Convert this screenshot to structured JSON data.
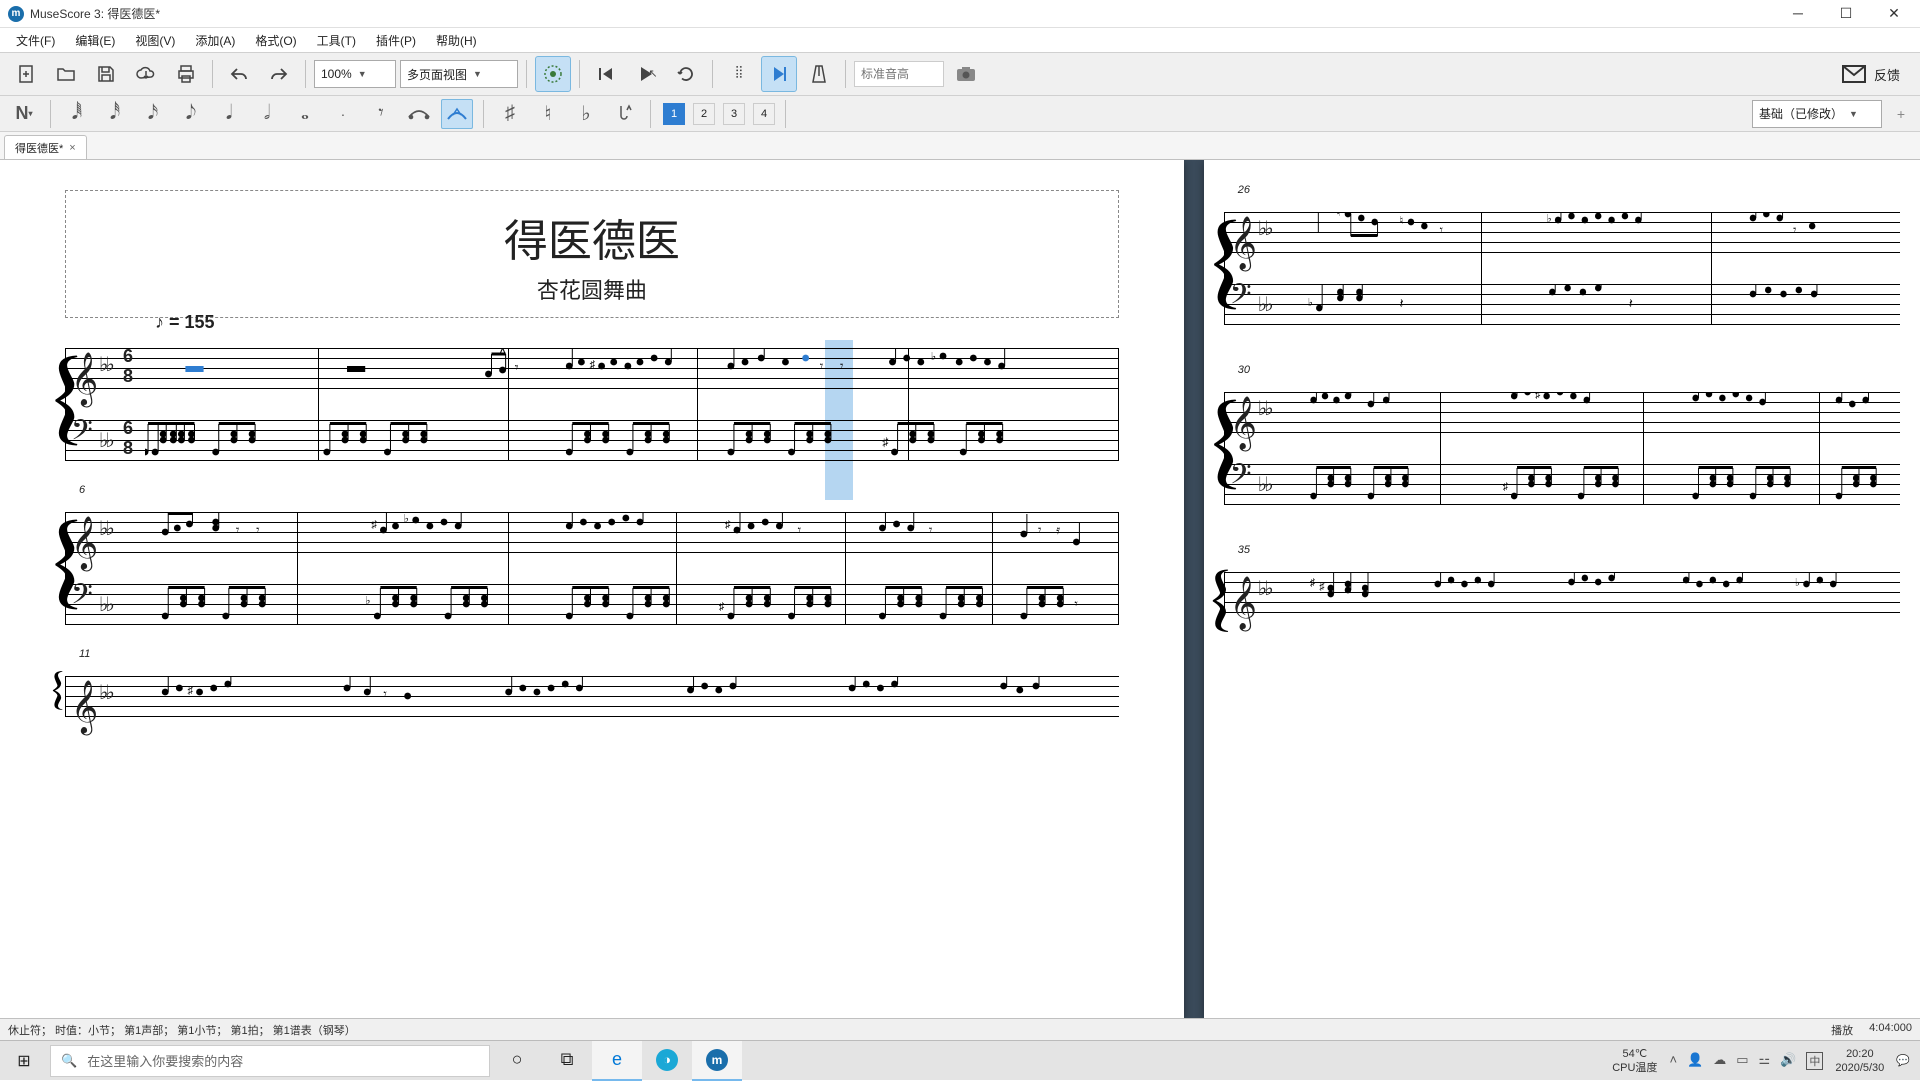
{
  "window": {
    "title": "MuseScore 3: 得医德医*"
  },
  "menu": {
    "file": "文件(F)",
    "edit": "编辑(E)",
    "view": "视图(V)",
    "add": "添加(A)",
    "format": "格式(O)",
    "tools": "工具(T)",
    "plugins": "插件(P)",
    "help": "帮助(H)"
  },
  "toolbar": {
    "zoom": "100%",
    "view_mode": "多页面视图",
    "pitch_placeholder": "标准音高",
    "feedback": "反馈"
  },
  "note_input": {
    "voices": {
      "v1": "1",
      "v2": "2",
      "v3": "3",
      "v4": "4",
      "add": "+"
    },
    "layout": "基础（已修改）"
  },
  "tab": {
    "name": "得医德医*",
    "close": "×"
  },
  "score": {
    "title": "得医德医",
    "subtitle": "杏花圆舞曲",
    "tempo": "♪ = 155",
    "sys2_num": "6",
    "sys3_num": "11",
    "p2_sys1_num": "26",
    "p2_sys2_num": "30",
    "p2_sys3_num": "35"
  },
  "status": {
    "left": "休止符；  时值：小节；  第1声部；  第1小节；  第1拍；  第1谱表（钢琴）",
    "mode": "播放",
    "time": "4:04:000"
  },
  "taskbar": {
    "search_placeholder": "在这里输入你要搜索的内容",
    "temp": "54℃",
    "cpu": "CPU温度",
    "ime": "中",
    "clock_time": "20:20",
    "clock_date": "2020/5/30"
  }
}
